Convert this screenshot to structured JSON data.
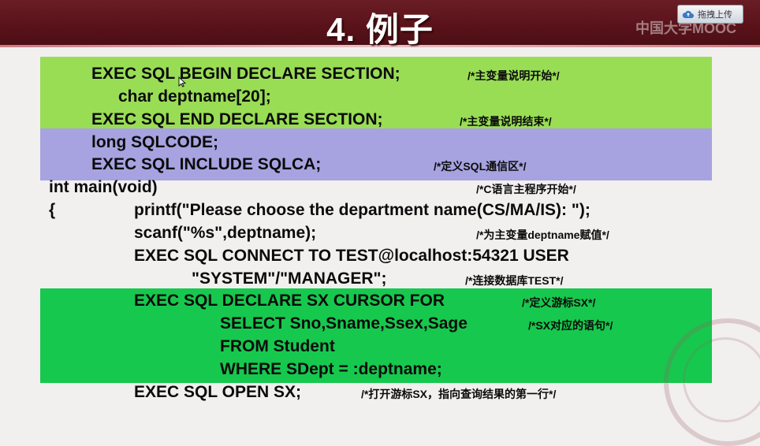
{
  "slide": {
    "title": "4. 例子",
    "upload_button": "拖拽上传",
    "watermark": "中国大学MOOC"
  },
  "code_lines": [
    {
      "code": "EXEC SQL BEGIN DECLARE SECTION;",
      "comment": "/*主变量说明开始*/"
    },
    {
      "code": "char deptname[20];",
      "comment": ""
    },
    {
      "code": "EXEC SQL END DECLARE SECTION;",
      "comment": "/*主变量说明结束*/"
    },
    {
      "code": "long SQLCODE;",
      "comment": ""
    },
    {
      "code": "EXEC SQL INCLUDE SQLCA;",
      "comment": "/*定义SQL通信区*/"
    },
    {
      "code": "int main(void)",
      "comment": "/*C语言主程序开始*/"
    },
    {
      "code": "{",
      "comment": ""
    },
    {
      "code": "printf(\"Please choose the department name(CS/MA/IS): \");",
      "comment": ""
    },
    {
      "code": "scanf(\"%s\",deptname);",
      "comment": "/*为主变量deptname赋值*/"
    },
    {
      "code": "EXEC SQL CONNECT TO TEST@localhost:54321 USER",
      "comment": ""
    },
    {
      "code": "\"SYSTEM\"/\"MANAGER\";",
      "comment": "/*连接数据库TEST*/"
    },
    {
      "code": "EXEC SQL DECLARE SX CURSOR FOR",
      "comment": "/*定义游标SX*/"
    },
    {
      "code": "SELECT Sno,Sname,Ssex,Sage",
      "comment": "/*SX对应的语句*/"
    },
    {
      "code": "FROM Student",
      "comment": ""
    },
    {
      "code": "WHERE SDept = :deptname;",
      "comment": ""
    },
    {
      "code": "EXEC SQL OPEN SX;",
      "comment": "/*打开游标SX，指向查询结果的第一行*/"
    }
  ],
  "colors": {
    "header": "#5a121a",
    "band_declare": "#99dd55",
    "band_sqlca": "#a7a3e0",
    "band_cursor": "#17c84e"
  },
  "icons": [
    "cloud-upload-icon",
    "mouse-cursor-icon",
    "university-seal"
  ]
}
